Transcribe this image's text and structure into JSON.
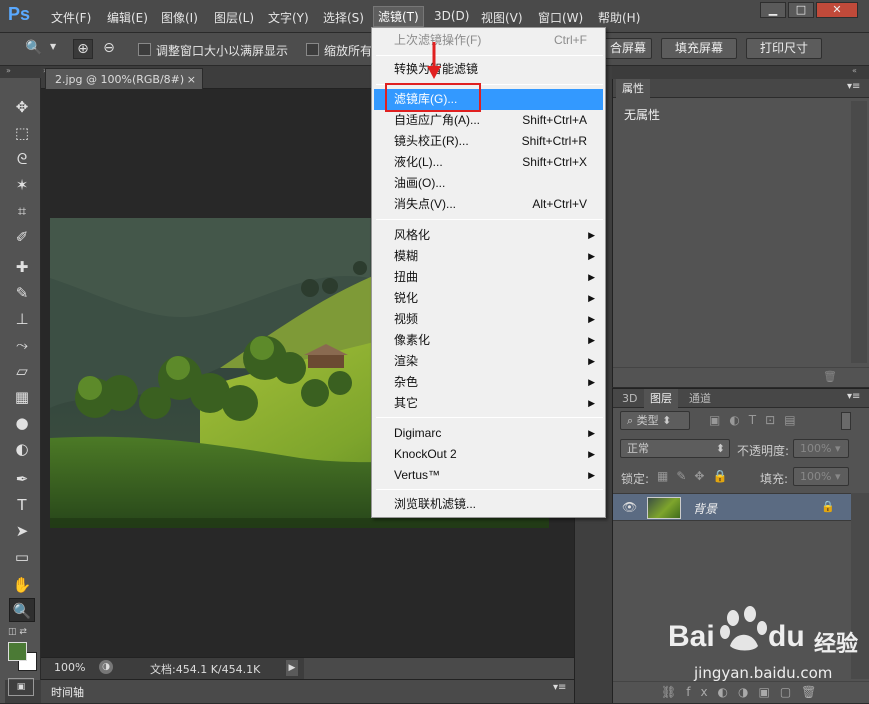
{
  "app": {
    "logo": "Ps"
  },
  "menubar": {
    "items": [
      "文件(F)",
      "编辑(E)",
      "图像(I)",
      "图层(L)",
      "文字(Y)",
      "选择(S)",
      "滤镜(T)",
      "3D(D)",
      "视图(V)",
      "窗口(W)",
      "帮助(H)"
    ],
    "active": "滤镜(T)"
  },
  "window_controls": {
    "minimize": "▁",
    "maximize": "□",
    "close": "✕"
  },
  "options": {
    "resize_checkbox": "调整窗口大小以满屏显示",
    "zoom_all_checkbox": "缩放所有",
    "fit_screen": "合屏幕",
    "fill_screen": "填充屏幕",
    "print_size": "打印尺寸"
  },
  "document": {
    "tab_title": "2.jpg @ 100%(RGB/8#)",
    "tab_close": "×",
    "zoom": "100%",
    "doc_info": "文档:454.1 K/454.1K"
  },
  "timeline": {
    "label": "时间轴"
  },
  "filter_menu": {
    "last_filter": {
      "label": "上次滤镜操作(F)",
      "shortcut": "Ctrl+F"
    },
    "smart_filter": {
      "label": "转换为智能滤镜"
    },
    "group1": [
      {
        "label": "滤镜库(G)...",
        "shortcut": ""
      },
      {
        "label": "自适应广角(A)...",
        "shortcut": "Shift+Ctrl+A"
      },
      {
        "label": "镜头校正(R)...",
        "shortcut": "Shift+Ctrl+R"
      },
      {
        "label": "液化(L)...",
        "shortcut": "Shift+Ctrl+X"
      },
      {
        "label": "油画(O)...",
        "shortcut": ""
      },
      {
        "label": "消失点(V)...",
        "shortcut": "Alt+Ctrl+V"
      }
    ],
    "group2": [
      "风格化",
      "模糊",
      "扭曲",
      "锐化",
      "视频",
      "像素化",
      "渲染",
      "杂色",
      "其它"
    ],
    "group3": [
      "Digimarc",
      "KnockOut 2",
      "Vertus™"
    ],
    "browse": "浏览联机滤镜..."
  },
  "properties": {
    "tab": "属性",
    "value": "无属性"
  },
  "layers_panel": {
    "tabs": [
      "3D",
      "图层",
      "通道"
    ],
    "kind": "类型",
    "blend_mode": "正常",
    "opacity_label": "不透明度:",
    "opacity": "100%",
    "lock_label": "锁定:",
    "fill_label": "填充:",
    "fill": "100%",
    "layer_name": "背景"
  },
  "watermark": {
    "brand": "Bai",
    "brand2": "du",
    "suffix": "经验",
    "url": "jingyan.baidu.com"
  }
}
